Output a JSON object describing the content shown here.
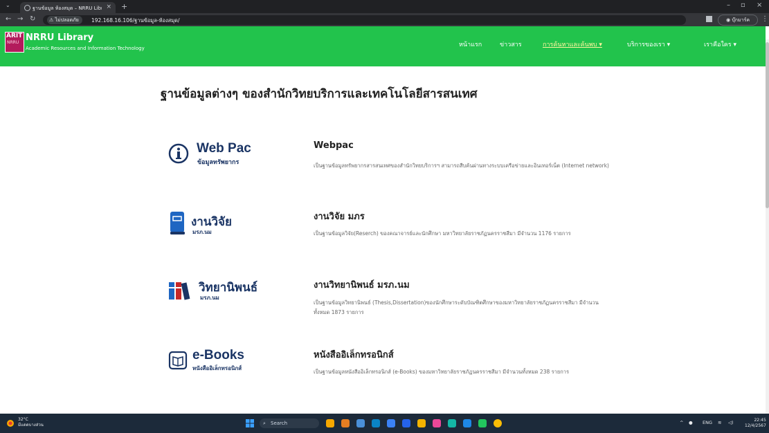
{
  "browser": {
    "tab_title": "ฐานข้อมูล ห้องสมุด – NRRU Librar...",
    "new_tab": "+",
    "url_warning": "ไม่ปลอดภัย",
    "url": "192.168.16.106/ฐานข้อมูล-ห้องสมุด/",
    "profile_label": "บุ๊กมาร์ค"
  },
  "site": {
    "logo_text": "ARIT",
    "logo_sub": "NRRU",
    "brand": "NRRU Library",
    "brand_sub": "Academic Resources and Information Technology",
    "menu": [
      {
        "label": "หน้าแรก"
      },
      {
        "label": "ข่าวสาร"
      },
      {
        "label": "การค้นหาและค้นพบ ▾"
      },
      {
        "label": "บริการของเรา ▾"
      },
      {
        "label": "เราคือใคร ▾"
      }
    ]
  },
  "main": {
    "title": "ฐานข้อมูลต่างๆ ของสำนักวิทยบริการและเทคโนโลยีสารสนเทศ",
    "items": [
      {
        "logo_title": "Web Pac",
        "logo_sub": "ข้อมูลทรัพยากร",
        "title": "Webpac",
        "desc": "เป็นฐานข้อมูลทรัพยากรสารสนเทศของสำนักวิทยบริการฯ สามารถสืบค้นผ่านทางระบบเครือข่ายและอินเทอร์เน็ต (Internet network)"
      },
      {
        "logo_title": "งานวิจัย",
        "logo_sub": "มรภ.นม",
        "title": "งานวิจัย มภร",
        "desc": "เป็นฐานข้อมูลวิจัย(Reserch) ของคณาจารย์และนักศึกษา มหาวิทยาลัยราชภัฏนครราชสีมา มีจำนวน 1176 รายการ"
      },
      {
        "logo_title": "วิทยานิพนธ์",
        "logo_sub": "มรภ.นม",
        "title": "งานวิทยานิพนธ์ มรภ.นม",
        "desc": "เป็นฐานข้อมูลวิทยานิพนธ์ (Thesis,Dissertation)ของนักศึกษาระดับบัณฑิตศึกษาของมหาวิทยาลัยราชภัฏนครราชสีมา มีจำนวนทั้งหมด 1873 รายการ"
      },
      {
        "logo_title": "e-Books",
        "logo_sub": "หนังสืออิเล็กทรอนิกส์",
        "title": "หนังสืออิเล็กทรอนิกส์",
        "desc": "เป็นฐานข้อมูลหนังสืออิเล็กทรอนิกส์ (e-Books) ของมหาวิทยาลัยราชภัฏนครราชสีมา มีจำนวนทั้งหมด 238 รายการ"
      }
    ]
  },
  "taskbar": {
    "temp": "32°C",
    "weather": "มีแดดบางส่วน",
    "search": "Search",
    "lang": "ENG",
    "time": "22:45",
    "date": "12/4/2567"
  },
  "colors": {
    "header_green": "#22c34c",
    "logo_navy": "#1a3464"
  }
}
